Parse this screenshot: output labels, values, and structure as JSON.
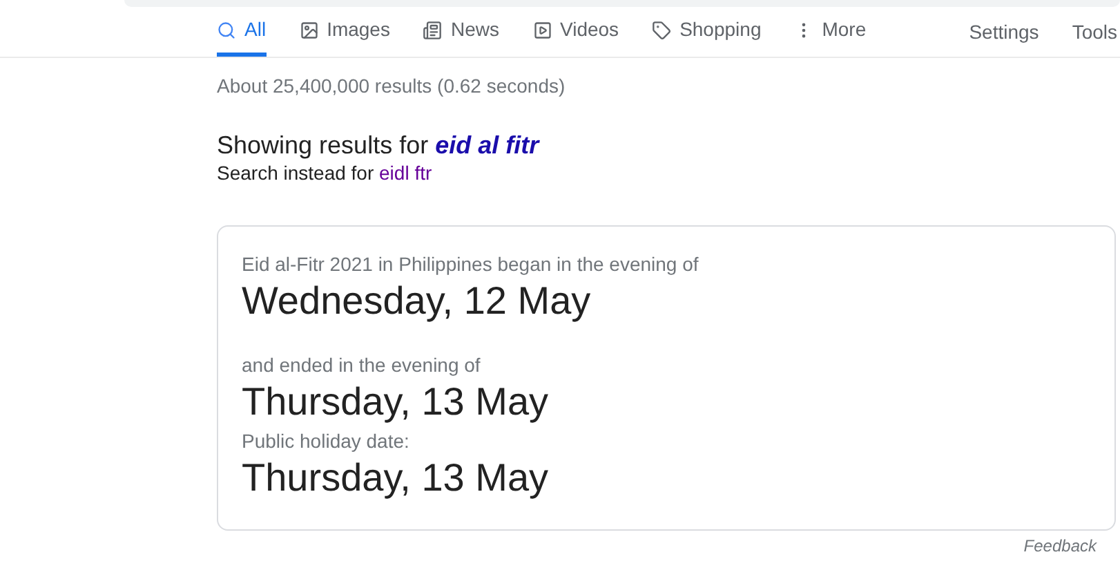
{
  "tabs": [
    {
      "label": "All",
      "selected": true
    },
    {
      "label": "Images",
      "selected": false
    },
    {
      "label": "News",
      "selected": false
    },
    {
      "label": "Videos",
      "selected": false
    },
    {
      "label": "Shopping",
      "selected": false
    },
    {
      "label": "More",
      "selected": false
    }
  ],
  "tools": [
    "Settings",
    "Tools"
  ],
  "result_stats": "About 25,400,000 results (0.62 seconds)",
  "correction": {
    "showing_label": "Showing results for",
    "corrected_query": "eid al fitr",
    "instead_label": "Search instead for",
    "original_query": "eidl ftr"
  },
  "answer_card": {
    "sections": [
      {
        "caption": "Eid al-Fitr 2021 in Philippines began in the evening of",
        "date": "Wednesday, 12 May"
      },
      {
        "caption": "and ended in the evening of",
        "date": "Thursday, 13 May"
      },
      {
        "caption": "Public holiday date:",
        "date": "Thursday, 13 May"
      }
    ]
  },
  "feedback": "Feedback"
}
